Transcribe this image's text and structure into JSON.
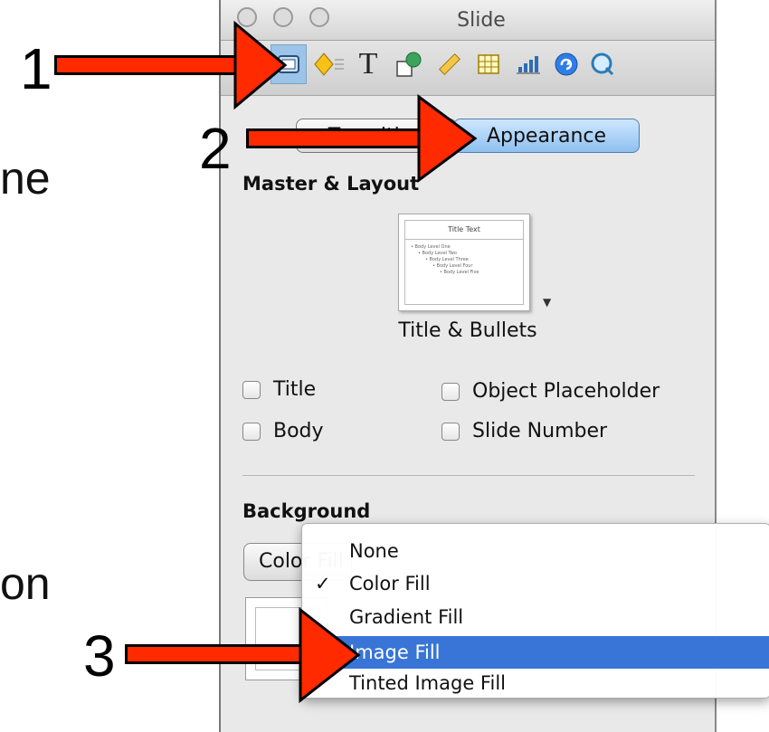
{
  "background_text": {
    "frag1": "ne",
    "frag2": "on"
  },
  "window": {
    "title": "Slide"
  },
  "toolbar": {
    "icons": [
      "slide-inspector-icon",
      "transition-icon",
      "text-icon",
      "graphic-icon",
      "metrics-icon",
      "table-icon",
      "chart-icon",
      "hyperlink-icon",
      "quicktime-icon"
    ]
  },
  "tabs": {
    "transition": "Transition",
    "appearance": "Appearance"
  },
  "master_layout": {
    "heading": "Master & Layout",
    "thumb_title": "Title Text",
    "thumb_bullets": [
      "• Body Level One",
      "• Body Level Two",
      "• Body Level Three",
      "• Body Level Four",
      "• Body Level Five"
    ],
    "layout_name": "Title & Bullets"
  },
  "checkboxes": {
    "title": "Title",
    "body": "Body",
    "object_placeholder": "Object Placeholder",
    "slide_number": "Slide Number"
  },
  "background": {
    "heading": "Background",
    "popup_value": "Color Fill"
  },
  "menu": {
    "items": [
      "None",
      "Color Fill",
      "Gradient Fill",
      "Image Fill",
      "Tinted Image Fill"
    ],
    "checked": "Color Fill",
    "highlighted": "Image Fill",
    "check_mark": "✓"
  },
  "callouts": {
    "one": "1",
    "two": "2",
    "three": "3"
  },
  "colors": {
    "highlight": "#3875d7",
    "arrow": "#ff2a00",
    "tab_active": "#8ec0f0"
  }
}
